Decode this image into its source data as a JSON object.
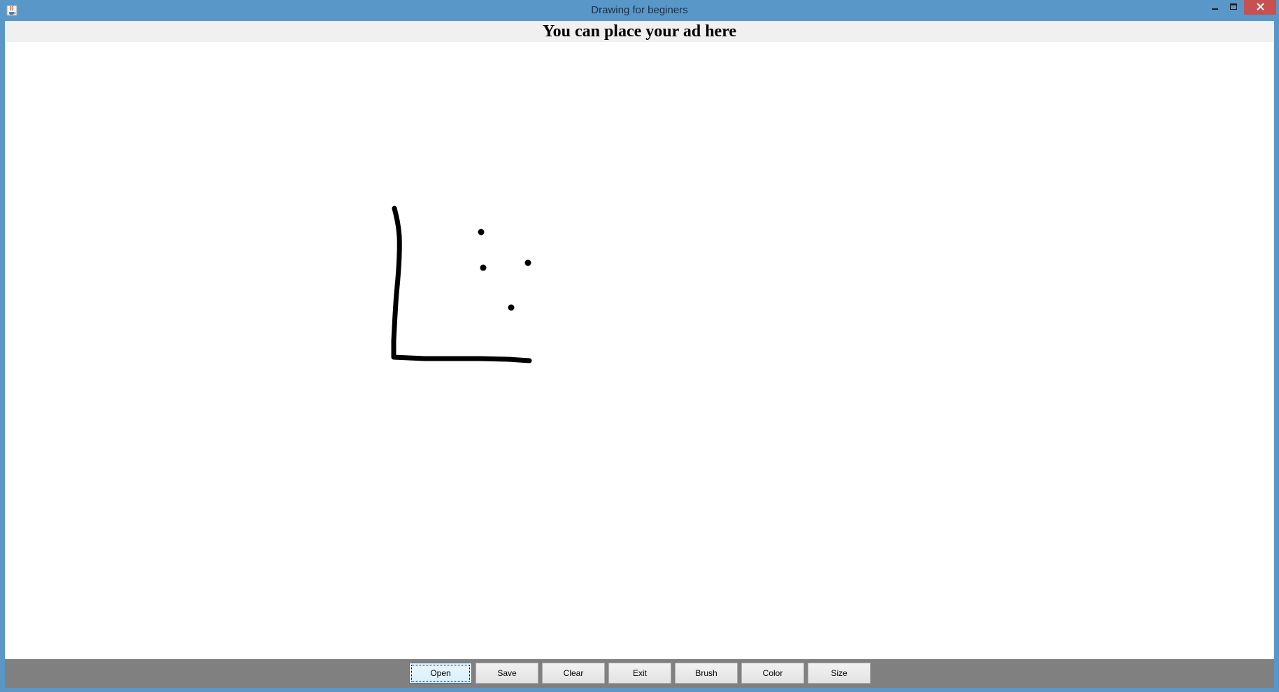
{
  "window": {
    "title": "Drawing for beginers",
    "icons": {
      "app": "java-coffee-icon",
      "minimize": "minimize-icon",
      "maximize": "maximize-icon",
      "close": "close-icon"
    },
    "colors": {
      "frame": "#5a97c9",
      "close_button": "#c75050"
    }
  },
  "banner": {
    "text": "You can place your ad here"
  },
  "canvas": {
    "stroke_color": "#000000",
    "background": "#ffffff"
  },
  "toolbar": {
    "buttons": [
      {
        "label": "Open",
        "focused": true
      },
      {
        "label": "Save"
      },
      {
        "label": "Clear"
      },
      {
        "label": "Exit"
      },
      {
        "label": "Brush"
      },
      {
        "label": "Color"
      },
      {
        "label": "Size"
      }
    ],
    "background": "#808080"
  }
}
